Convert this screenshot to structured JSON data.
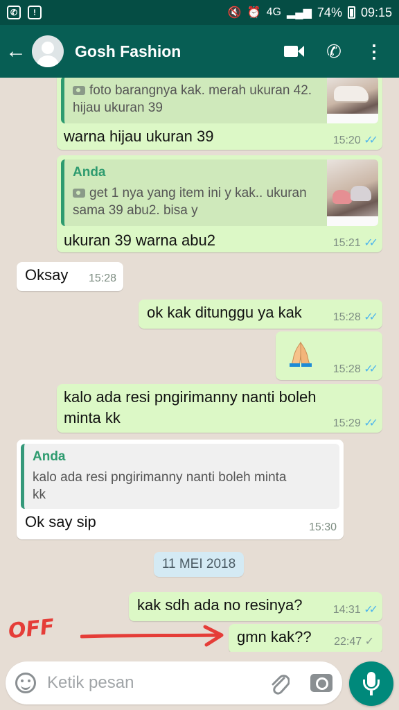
{
  "status_bar": {
    "network": "4G",
    "battery": "74%",
    "time": "09:15"
  },
  "header": {
    "contact_name": "Gosh Fashion"
  },
  "messages": [
    {
      "dir": "out",
      "quote_text": "foto barangnya kak. merah ukuran 42. hijau ukuran 39",
      "text": "warna hijau ukuran 39",
      "time": "15:20",
      "ticks": "✓✓"
    },
    {
      "dir": "out",
      "quote_author": "Anda",
      "quote_text": "get 1 nya yang item ini y kak.. ukuran sama 39 abu2. bisa y",
      "text": "ukuran 39 warna abu2",
      "time": "15:21",
      "ticks": "✓✓"
    },
    {
      "dir": "in",
      "text": "Oksay",
      "time": "15:28"
    },
    {
      "dir": "out",
      "text": "ok kak ditunggu ya kak",
      "time": "15:28",
      "ticks": "✓✓"
    },
    {
      "dir": "out",
      "text": "🙏",
      "time": "15:28",
      "ticks": "✓✓"
    },
    {
      "dir": "out",
      "text_line1": "kalo ada resi pngirimanny nanti boleh",
      "text_line2": "minta kk",
      "time": "15:29",
      "ticks": "✓✓"
    },
    {
      "dir": "in",
      "quote_author": "Anda",
      "quote_line1": "kalo ada resi pngirimanny nanti boleh minta",
      "quote_line2": "kk",
      "text": "Ok say sip",
      "time": "15:30"
    },
    {
      "dir": "out",
      "text": "kak sdh ada no resinya?",
      "time": "14:31",
      "ticks": "✓✓"
    },
    {
      "dir": "out",
      "text": "gmn kak??",
      "time": "22:47",
      "ticks": "✓"
    }
  ],
  "date_divider": "11 MEI 2018",
  "annotation": {
    "note": "OFF",
    "color": "#e53d38"
  },
  "input_bar": {
    "placeholder": "Ketik pesan"
  },
  "colors": {
    "header": "#075e54",
    "status_bar": "#054d44",
    "outgoing_bubble": "#dcf8c6",
    "incoming_bubble": "#ffffff",
    "read_ticks": "#4fb6ec",
    "mic_button": "#00897b"
  },
  "icons": [
    "whatsapp-icon",
    "alert-icon",
    "mute-icon",
    "alarm-icon",
    "signal-icon",
    "battery-icon",
    "back-arrow-icon",
    "video-call-icon",
    "phone-icon",
    "more-options-icon",
    "emoji-icon",
    "attach-icon",
    "camera-icon",
    "mic-icon"
  ]
}
